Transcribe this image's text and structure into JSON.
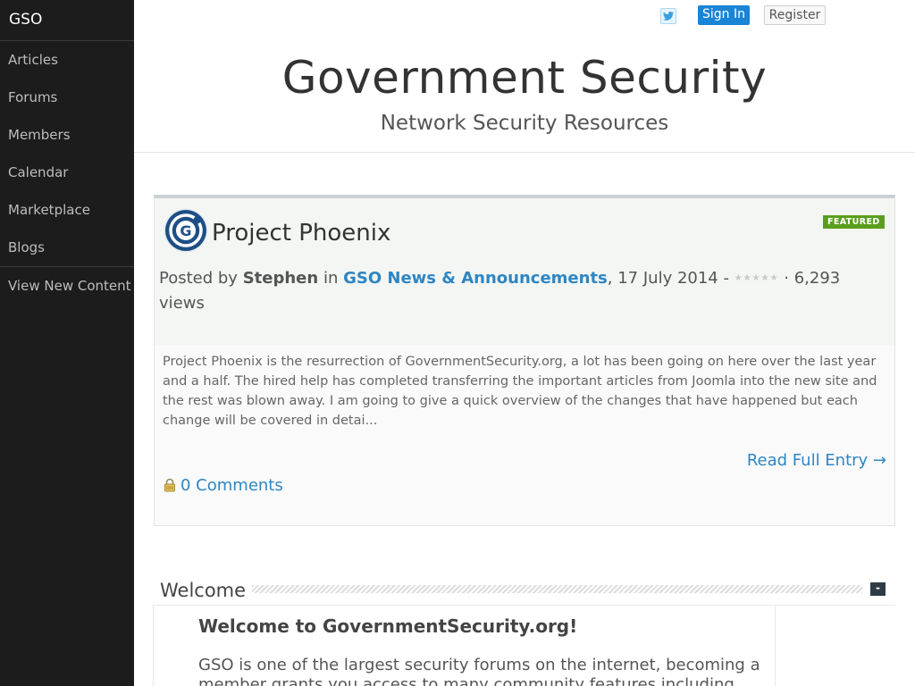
{
  "sidebar": {
    "brand": "GSO",
    "items": [
      {
        "label": "Articles"
      },
      {
        "label": "Forums"
      },
      {
        "label": "Members"
      },
      {
        "label": "Calendar"
      },
      {
        "label": "Marketplace"
      },
      {
        "label": "Blogs"
      },
      {
        "label": "View New Content"
      }
    ]
  },
  "header": {
    "twitter_icon": "twitter-icon",
    "sign_in": "Sign In",
    "register": "Register",
    "title": "Government Security",
    "subtitle": "Network Security Resources"
  },
  "entry": {
    "logo": "gso-logo-icon",
    "title": "Project Phoenix",
    "badge": "FEATURED",
    "posted_by_label": "Posted by",
    "author": "Stephen",
    "in_label": "in",
    "category": "GSO News & Announcements",
    "date": ", 17 July 2014 -",
    "rating": "★★★★★",
    "views": "· 6,293 views",
    "body": "Project Phoenix is the resurrection of GovernmentSecurity.org, a lot has been going on here over the last year and a half. The hired help has completed transferring the important articles from Joomla into the new site and the rest was blown away. I am going to give a quick overview of the changes that have happened but each change will be covered in detai...",
    "read_more": "Read Full Entry →",
    "comments": "0 Comments"
  },
  "welcome": {
    "label": "Welcome",
    "collapse": "-",
    "title": "Welcome to GovernmentSecurity.org!",
    "text": "GSO is one of the largest security forums on the internet, becoming a member grants you access to many community features including"
  },
  "colors": {
    "sidebar_bg": "#1c1c1c",
    "accent": "#1a84d6",
    "link": "#2f86c2",
    "featured_badge": "#5a9e1e"
  }
}
